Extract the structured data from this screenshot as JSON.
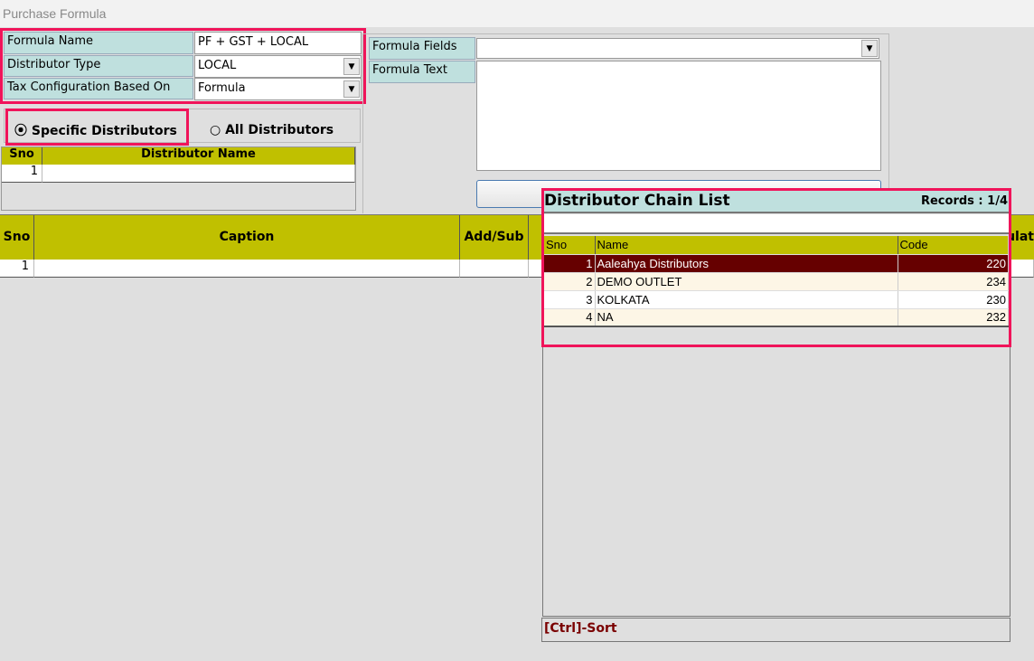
{
  "window": {
    "title": "Purchase Formula"
  },
  "form": {
    "formula_name_label": "Formula Name",
    "formula_name_value": "PF + GST + LOCAL",
    "distributor_type_label": "Distributor Type",
    "distributor_type_value": "LOCAL",
    "tax_config_label": "Tax Configuration Based On",
    "tax_config_value": "Formula",
    "formula_fields_label": "Formula Fields",
    "formula_fields_value": "",
    "formula_text_label": "Formula Text",
    "formula_text_value": ""
  },
  "radios": {
    "specific": "Specific Distributors",
    "all": "All Distributors",
    "selected": "specific"
  },
  "distributor_grid": {
    "headers": [
      "Sno",
      "Distributor Name"
    ],
    "rows": [
      {
        "sno": "1",
        "name": ""
      }
    ]
  },
  "main_grid": {
    "headers": [
      "Sno",
      "Caption",
      "Add/Sub",
      "ulat"
    ],
    "rows": [
      {
        "sno": "1"
      }
    ]
  },
  "popup": {
    "title": "Distributor Chain List",
    "records": "Records : 1/4",
    "search": "",
    "headers": [
      "Sno",
      "Name",
      "Code"
    ],
    "rows": [
      {
        "sno": "1",
        "name": "Aaleahya  Distributors",
        "code": "220"
      },
      {
        "sno": "2",
        "name": "DEMO OUTLET",
        "code": "234"
      },
      {
        "sno": "3",
        "name": "KOLKATA",
        "code": "230"
      },
      {
        "sno": "4",
        "name": "NA",
        "code": "232"
      }
    ],
    "footer": "[Ctrl]-Sort"
  },
  "colors": {
    "highlight": "#f0145a",
    "header": "#c0c000",
    "label": "#bfe0de",
    "selected": "#660000"
  }
}
